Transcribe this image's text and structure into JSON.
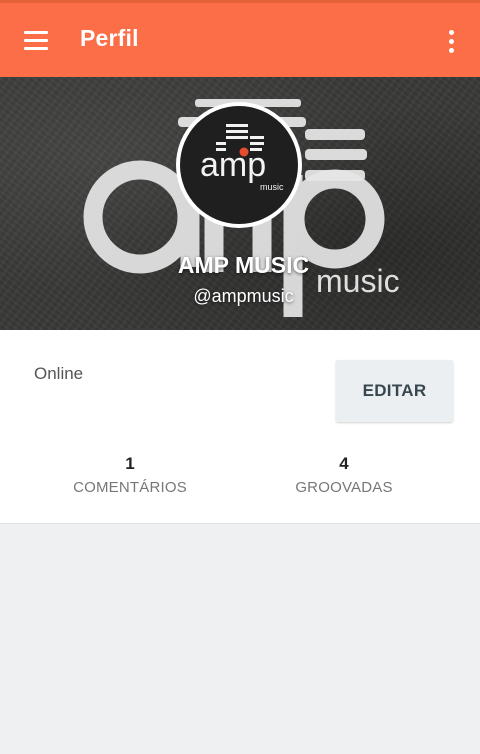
{
  "app_bar": {
    "title": "Perfil",
    "menu_icon": "hamburger-menu-icon",
    "overflow_icon": "more-vertical-icon",
    "color": "#fc6e47"
  },
  "profile": {
    "name": "AMP MUSIC",
    "handle": "@ampmusic",
    "status": "Online",
    "cover_logo_text": "amp",
    "cover_logo_subtext": "music",
    "avatar_logo_text": "amp",
    "avatar_logo_subtext": "music"
  },
  "actions": {
    "edit_label": "EDITAR"
  },
  "stats": [
    {
      "count": "1",
      "label": "COMENTÁRIOS"
    },
    {
      "count": "4",
      "label": "GROOVADAS"
    }
  ],
  "colors": {
    "accent": "#fc6e47",
    "cover_bg": "#3a3a39",
    "page_bg": "#eef0f1"
  }
}
